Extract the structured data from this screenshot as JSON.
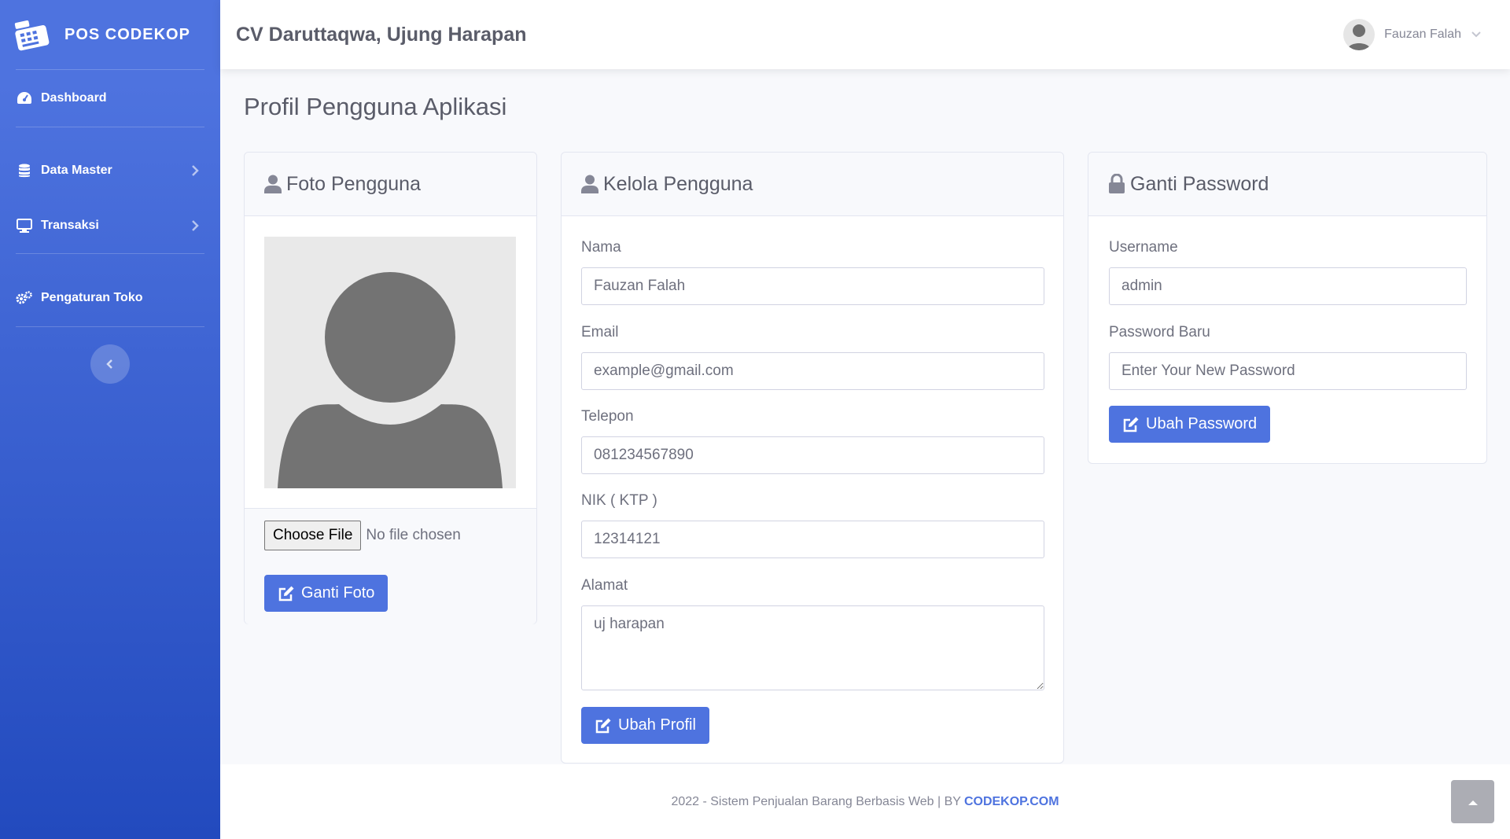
{
  "brand": {
    "name": "POS CODEKOP"
  },
  "sidebar": {
    "items": [
      {
        "label": "Dashboard"
      },
      {
        "label": "Data Master"
      },
      {
        "label": "Transaksi"
      },
      {
        "label": "Pengaturan Toko"
      }
    ]
  },
  "topbar": {
    "store_title": "CV Daruttaqwa, Ujung Harapan",
    "user_name": "Fauzan Falah"
  },
  "page": {
    "title": "Profil Pengguna Aplikasi"
  },
  "foto_card": {
    "title": "Foto Pengguna",
    "file_button": "Choose File",
    "file_status": "No file chosen",
    "submit_label": "Ganti Foto"
  },
  "kelola_card": {
    "title": "Kelola Pengguna",
    "fields": {
      "nama": {
        "label": "Nama",
        "value": "Fauzan Falah"
      },
      "email": {
        "label": "Email",
        "value": "example@gmail.com"
      },
      "telepon": {
        "label": "Telepon",
        "value": "081234567890"
      },
      "nik": {
        "label": "NIK ( KTP )",
        "value": "12314121"
      },
      "alamat": {
        "label": "Alamat",
        "value": "uj harapan"
      }
    },
    "submit_label": "Ubah Profil"
  },
  "password_card": {
    "title": "Ganti Password",
    "username": {
      "label": "Username",
      "value": "admin"
    },
    "new_password": {
      "label": "Password Baru",
      "placeholder": "Enter Your New Password"
    },
    "submit_label": "Ubah Password"
  },
  "footer": {
    "text": "2022 - Sistem Penjualan Barang Berbasis Web | BY",
    "link": "CODEKOP.COM"
  },
  "colors": {
    "primary": "#4e73df",
    "sidebar_end": "#224abe",
    "text": "#858796",
    "heading": "#5a5c69"
  }
}
